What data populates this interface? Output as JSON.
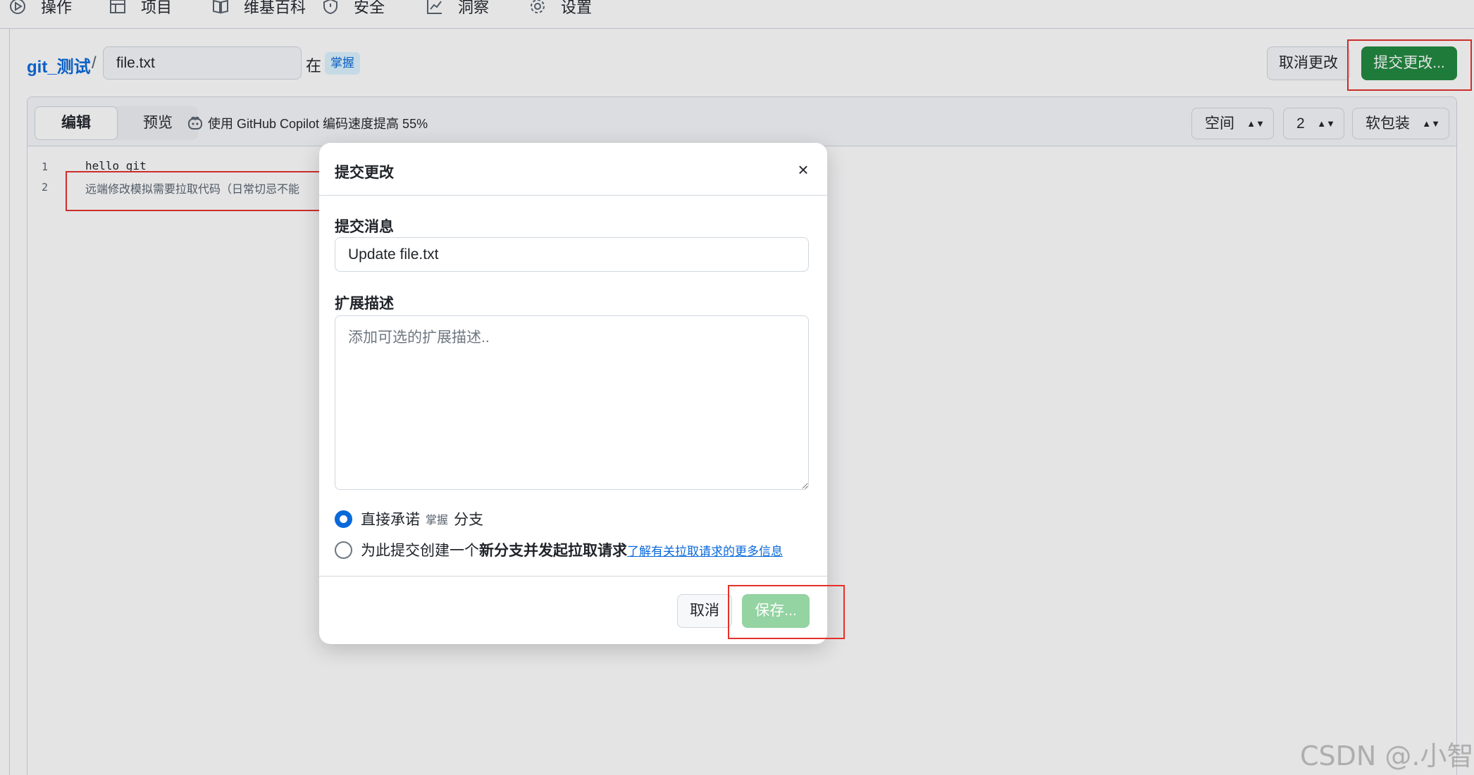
{
  "nav": {
    "actions": "操作",
    "projects": "项目",
    "wiki": "维基百科",
    "security": "安全",
    "insights": "洞察",
    "settings": "设置"
  },
  "header": {
    "repo": "git_测试",
    "slash": "/",
    "filename": "file.txt",
    "in_label": "在",
    "branch": "掌握",
    "cancel_changes_label": "取消更改",
    "commit_changes_label": "提交更改..."
  },
  "editor": {
    "tab_edit": "编辑",
    "tab_preview": "预览",
    "copilot_text": "使用 GitHub Copilot 编码速度提高 55%",
    "indent_mode": "空间",
    "indent_size": "2",
    "wrap_mode": "软包装",
    "lines": [
      {
        "no": "1",
        "text": "hello git"
      },
      {
        "no": "2",
        "text": "远端修改模拟需要拉取代码（日常切忌不能"
      }
    ]
  },
  "dialog": {
    "title": "提交更改",
    "close_glyph": "×",
    "message_label": "提交消息",
    "message_value": "Update file.txt",
    "description_label": "扩展描述",
    "description_placeholder": "添加可选的扩展描述..",
    "option_direct": {
      "prefix": "直接承诺",
      "branch": "掌握",
      "suffix": "分支"
    },
    "option_pr": {
      "prefix": "为此提交创建一个",
      "bold": "新分支并发起拉取请求",
      "link": "了解有关拉取请求的更多信息"
    },
    "cancel_label": "取消",
    "save_label": "保存..."
  },
  "watermark": "CSDN @.小智",
  "colors": {
    "primary_green": "#1f883d",
    "disabled_green": "#94d3a2",
    "link_blue": "#0969da",
    "annotation_red": "#e5302a"
  }
}
